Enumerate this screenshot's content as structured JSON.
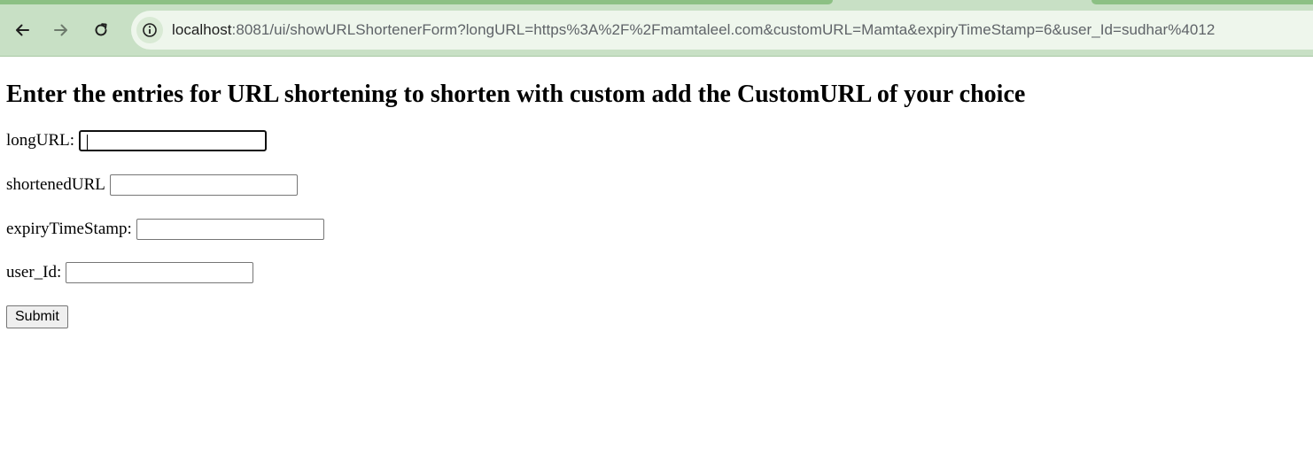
{
  "browser": {
    "url_host": "localhost",
    "url_rest": ":8081/ui/showURLShortenerForm?longURL=https%3A%2F%2Fmamtaleel.com&customURL=Mamta&expiryTimeStamp=6&user_Id=sudhar%4012",
    "back_icon": "arrow-left-icon",
    "forward_icon": "arrow-right-icon",
    "reload_icon": "reload-icon",
    "site_info_icon": "info-icon"
  },
  "form": {
    "heading": "Enter the entries for URL shortening to shorten with custom add the CustomURL of your choice",
    "fields": [
      {
        "label": "longURL:",
        "value": ""
      },
      {
        "label": "shortenedURL",
        "value": ""
      },
      {
        "label": "expiryTimeStamp:",
        "value": ""
      },
      {
        "label": "user_Id:",
        "value": ""
      }
    ],
    "submit_label": "Submit"
  }
}
